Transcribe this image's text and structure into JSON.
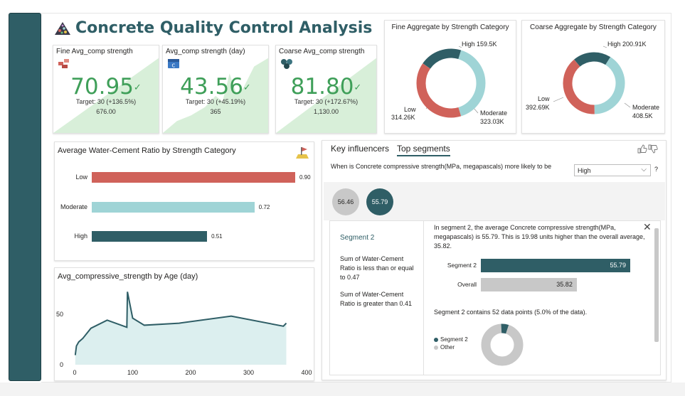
{
  "page": {
    "title": "Concrete Quality Control Analysis"
  },
  "colors": {
    "teal_dark": "#2f5e66",
    "teal_light": "#9fd4d6",
    "red": "#d0625a",
    "green": "#3f9f59",
    "kpi_area": "#d8efd9",
    "gray_bar": "#c8c8c8"
  },
  "kpis": [
    {
      "title": "Fine Avg_comp strength",
      "icon": "bricks-icon",
      "value": "70.95",
      "target": "Target: 30 (+136.5%)",
      "count": "676.00"
    },
    {
      "title": "Avg_comp strength (day)",
      "icon": "calendar-icon",
      "value": "43.56",
      "target": "Target: 30 (+45.19%)",
      "count": "365"
    },
    {
      "title": "Coarse Avg_comp strength",
      "icon": "stones-icon",
      "value": "81.80",
      "target": "Target: 30 (+172.67%)",
      "count": "1,130.00"
    }
  ],
  "fine_donut": {
    "title": "Fine Aggregate by Strength Category",
    "labels": {
      "high": "High 159.5K",
      "low_name": "Low",
      "low_value": "314.26K",
      "moderate_name": "Moderate",
      "moderate_value": "323.03K"
    }
  },
  "coarse_donut": {
    "title": "Coarse Aggregate by Strength Category",
    "labels": {
      "high": "High 200.91K",
      "low_name": "Low",
      "low_value": "392.69K",
      "moderate_name": "Moderate",
      "moderate_value": "408.5K"
    }
  },
  "wc_chart": {
    "title": "Average Water-Cement Ratio by Strength Category",
    "icon": "construction-sign-icon"
  },
  "age_chart": {
    "title": "Avg_compressive_strength by Age (day)"
  },
  "key_influencers": {
    "tabs": [
      "Key influencers",
      "Top segments"
    ],
    "active_tab": "Top segments",
    "question": "When is Concrete compressive strength(MPa, megapascals) more likely to be",
    "selected_value": "High",
    "help": "?",
    "bubbles": [
      "56.46",
      "55.79"
    ],
    "segment": {
      "name": "Segment 2",
      "condition_1": "Sum of Water-Cement Ratio is less than or equal to 0.47",
      "condition_2": "Sum of Water-Cement Ratio is greater than 0.41",
      "description": "In segment 2, the average Concrete compressive strength(MPa, megapascals) is 55.79. This is 19.98 units higher than the overall average, 35.82.",
      "compare": [
        {
          "label": "Segment 2",
          "value": 55.79,
          "display": "55.79"
        },
        {
          "label": "Overall",
          "value": 35.82,
          "display": "35.82"
        }
      ],
      "count_text": "Segment 2 contains 52 data points (5.0% of the data).",
      "legend": [
        "Segment 2",
        "Other"
      ],
      "share_pct": 5.0
    }
  },
  "chart_data": [
    {
      "type": "pie",
      "title": "Fine Aggregate by Strength Category",
      "categories": [
        "High",
        "Low",
        "Moderate"
      ],
      "values": [
        159.5,
        314.26,
        323.03
      ],
      "unit": "K",
      "colors": [
        "#2f5e66",
        "#d0625a",
        "#9fd4d6"
      ]
    },
    {
      "type": "pie",
      "title": "Coarse Aggregate by Strength Category",
      "categories": [
        "High",
        "Low",
        "Moderate"
      ],
      "values": [
        200.91,
        392.69,
        408.5
      ],
      "unit": "K",
      "colors": [
        "#2f5e66",
        "#d0625a",
        "#9fd4d6"
      ]
    },
    {
      "type": "bar",
      "title": "Average Water-Cement Ratio by Strength Category",
      "categories": [
        "Low",
        "Moderate",
        "High"
      ],
      "values": [
        0.9,
        0.72,
        0.51
      ],
      "xlim": [
        0,
        0.9
      ],
      "colors": [
        "#d0625a",
        "#9fd4d6",
        "#2f5e66"
      ]
    },
    {
      "type": "area",
      "title": "Avg_compressive_strength by Age (day)",
      "x": [
        1,
        3,
        7,
        14,
        28,
        56,
        90,
        91,
        100,
        120,
        180,
        270,
        360,
        365
      ],
      "values": [
        9.5,
        18.5,
        22.5,
        26,
        36,
        44,
        37,
        72,
        46,
        39,
        41,
        48,
        38,
        41
      ],
      "xlim": [
        0,
        400
      ],
      "ylim": [
        0,
        80
      ],
      "xticks": [
        0,
        100,
        200,
        300,
        400
      ],
      "yticks": [
        0,
        50
      ],
      "grid": false
    }
  ]
}
